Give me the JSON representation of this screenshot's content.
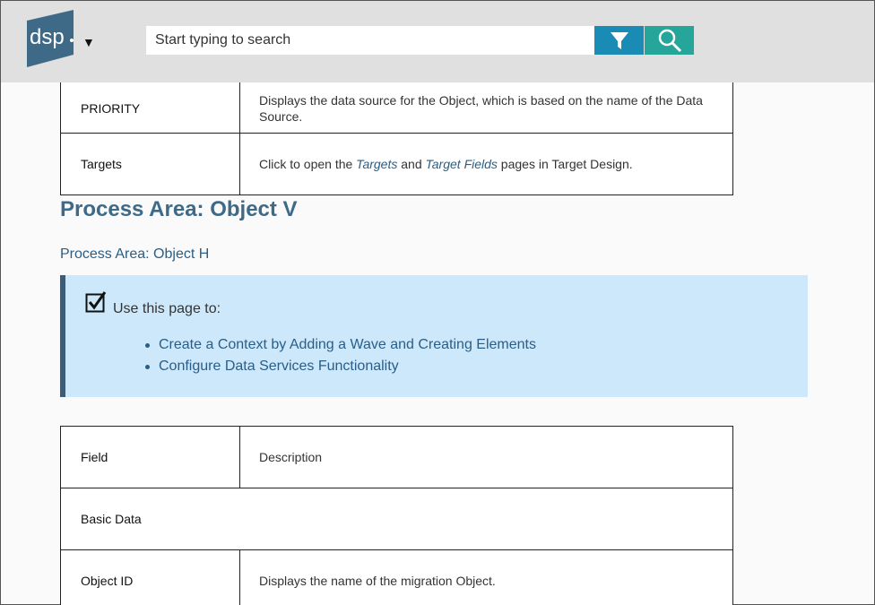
{
  "header": {
    "logo_text": "dsp",
    "search_placeholder": "Start typing to search",
    "logo_menu_label": "▼"
  },
  "top_table": {
    "rows": [
      {
        "field": "PRIORITY",
        "description": "Displays the data source for the Object, which is based on the name of the Data Source."
      },
      {
        "field": "Targets",
        "desc_prefix": "Click to open the ",
        "link1": "Targets",
        "desc_mid": " and ",
        "link2": "Target Fields",
        "desc_suffix": " pages in Target Design."
      }
    ]
  },
  "section": {
    "title": "Process Area: Object V",
    "breadcrumb": "Process Area: Object H"
  },
  "note": {
    "intro": "Use this page to:",
    "items": [
      "Create a Context by Adding a Wave and Creating Elements",
      "Configure Data Services Functionality"
    ]
  },
  "bottom_table": {
    "header_field": "Field",
    "header_desc": "Description",
    "group_label": "Basic Data",
    "rows": [
      {
        "field": "Object ID",
        "description": "Displays the name of the migration Object."
      }
    ]
  }
}
